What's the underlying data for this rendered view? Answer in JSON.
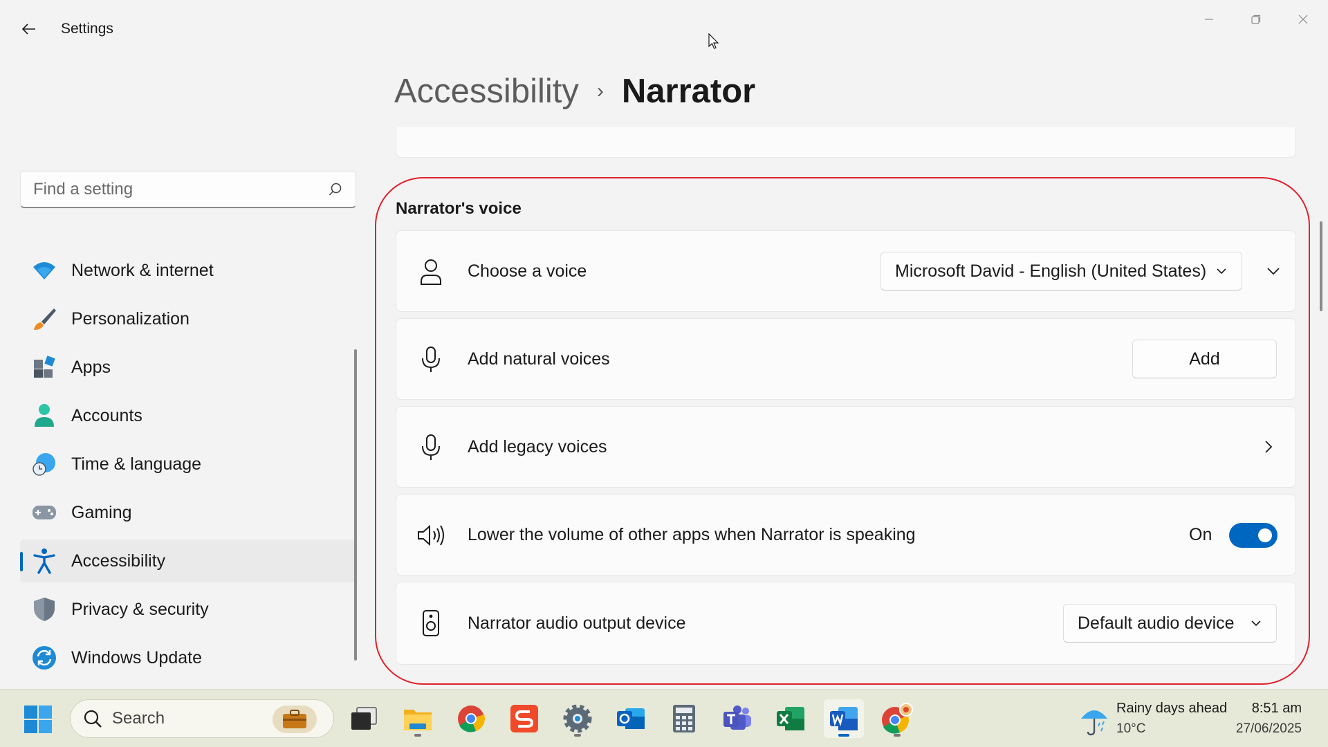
{
  "window": {
    "title": "Settings",
    "back_icon": "back-arrow-icon",
    "minimize_icon": "minimize-icon",
    "maximize_icon": "restore-icon",
    "close_icon": "close-icon"
  },
  "breadcrumb": {
    "parent": "Accessibility",
    "separator": "›",
    "current": "Narrator"
  },
  "search": {
    "placeholder": "Find a setting",
    "value": "",
    "icon": "search-icon"
  },
  "sidebar": {
    "items": [
      {
        "label": "Network & internet",
        "icon": "wifi-icon",
        "active": false
      },
      {
        "label": "Personalization",
        "icon": "paintbrush-icon",
        "active": false
      },
      {
        "label": "Apps",
        "icon": "apps-icon",
        "active": false
      },
      {
        "label": "Accounts",
        "icon": "person-icon",
        "active": false
      },
      {
        "label": "Time & language",
        "icon": "globe-clock-icon",
        "active": false
      },
      {
        "label": "Gaming",
        "icon": "gamepad-icon",
        "active": false
      },
      {
        "label": "Accessibility",
        "icon": "accessibility-icon",
        "active": true
      },
      {
        "label": "Privacy & security",
        "icon": "shield-icon",
        "active": false
      },
      {
        "label": "Windows Update",
        "icon": "update-icon",
        "active": false
      }
    ]
  },
  "section": {
    "title": "Narrator's voice"
  },
  "settings": {
    "choose_voice": {
      "label": "Choose a voice",
      "icon": "person-voice-icon",
      "selected": "Microsoft David - English (United States)"
    },
    "natural_voices": {
      "label": "Add natural voices",
      "icon": "microphone-icon",
      "button": "Add"
    },
    "legacy_voices": {
      "label": "Add legacy voices",
      "icon": "microphone-icon"
    },
    "lower_volume": {
      "label": "Lower the volume of other apps when Narrator is speaking",
      "icon": "speaker-icon",
      "state": "On",
      "enabled": true
    },
    "audio_output": {
      "label": "Narrator audio output device",
      "icon": "speaker-device-icon",
      "selected": "Default audio device"
    }
  },
  "taskbar": {
    "search_label": "Search",
    "apps": [
      "start-icon",
      "task-view-icon",
      "file-explorer-icon",
      "chrome-icon",
      "scribble-app-icon",
      "settings-icon",
      "outlook-icon",
      "calculator-icon",
      "teams-icon",
      "excel-icon",
      "word-icon",
      "chrome-profile-icon"
    ],
    "weather": {
      "condition": "Rainy days ahead",
      "temperature": "10°C",
      "icon": "umbrella-icon"
    },
    "clock": {
      "time": "8:51 am",
      "date": "27/06/2025"
    }
  },
  "colors": {
    "accent": "#0067c0",
    "annotation": "#e0202c",
    "taskbar": "#e6e9d8"
  }
}
